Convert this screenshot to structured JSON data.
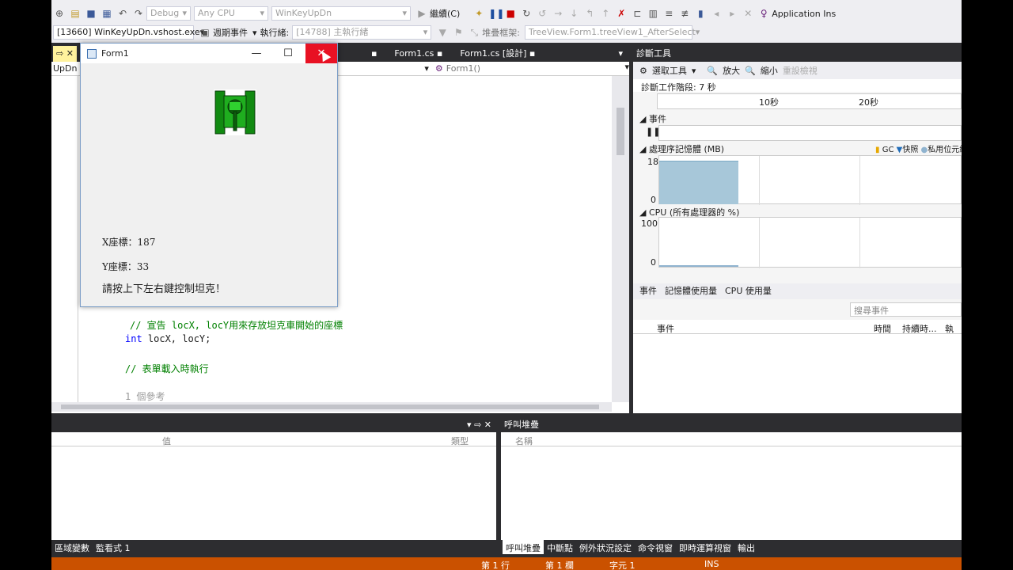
{
  "toolbar": {
    "config": "Debug",
    "platform": "Any CPU",
    "startup": "WinKeyUpDn",
    "continue": "繼續(C)",
    "app_insights": "Application Ins"
  },
  "toolbar2": {
    "process": "[13660] WinKeyUpDn.vshost.exe",
    "events": "週期事件",
    "thread_label": "執行緒:",
    "thread": "[14788] 主執行緒",
    "stack_label": "堆疊框架:",
    "stack": "TreeView.Form1.treeView1_AfterSelect"
  },
  "editor": {
    "tabs": [
      "Form1.cs",
      "Form1.cs [設計]"
    ],
    "nav_left": "UpDn",
    "nav_right": "Form1()",
    "lines": [
      {
        "t": "// 宣告 locX, locY用來存放坦克車開始的座標",
        "c": "cm"
      },
      {
        "t": "int",
        "c": "kw",
        "rest": " locX, locY;"
      },
      {
        "t": "// 表單載入時執行",
        "c": "cm"
      },
      {
        "t": "1 個參考",
        "c": "gr"
      }
    ]
  },
  "diag": {
    "title": "診斷工具",
    "select_tool": "選取工具",
    "zoom_in": "放大",
    "zoom_out": "縮小",
    "reset": "重設檢視",
    "session": "診斷工作階段: 7 秒",
    "t10": "10秒",
    "t20": "20秒",
    "events": "事件",
    "memory": "處理序記憶體 (MB)",
    "gc": "GC",
    "snapshot": "快照",
    "private": "私用位元組",
    "mem_max": "18",
    "mem_min": "0",
    "cpu": "CPU (所有處理器的 %)",
    "cpu_max": "100",
    "cpu_min": "0",
    "tabs": [
      "事件",
      "記憶體使用量",
      "CPU 使用量"
    ],
    "search": "搜尋事件",
    "col_event": "事件",
    "col_time": "時間",
    "col_dur": "持續時...",
    "col_thread": "執行"
  },
  "bottom_left": {
    "col_value": "值",
    "col_type": "類型",
    "tabs": [
      "區域變數",
      "監看式 1"
    ]
  },
  "bottom_right": {
    "title": "呼叫堆疊",
    "col_name": "名稱",
    "tabs": [
      "呼叫堆疊",
      "中斷點",
      "例外狀況設定",
      "命令視窗",
      "即時運算視窗",
      "輸出"
    ]
  },
  "status": {
    "line": "第 1 行",
    "col": "第 1 欄",
    "char": "字元 1",
    "ins": "INS"
  },
  "form": {
    "title": "Form1",
    "x_label": "X座標：187",
    "y_label": "Y座標：33",
    "hint": "請按上下左右鍵控制坦克！"
  }
}
